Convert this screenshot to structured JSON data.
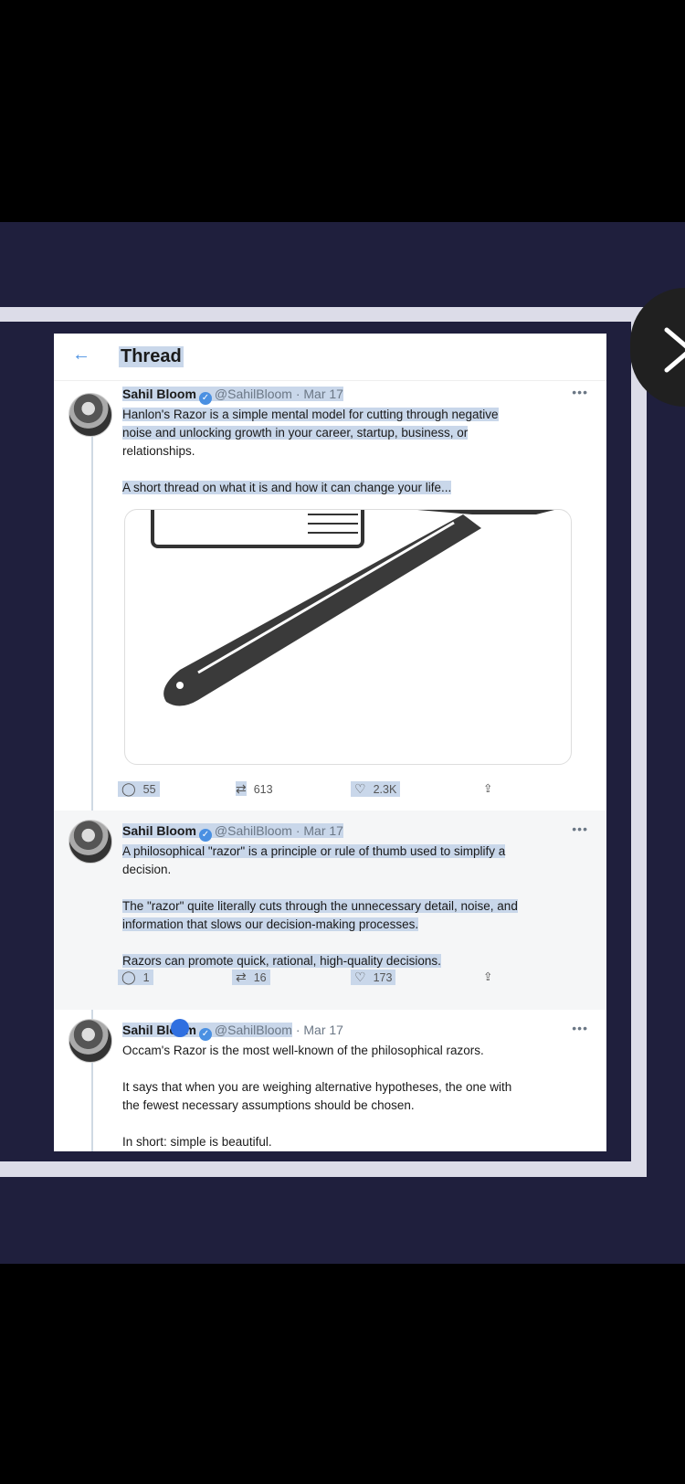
{
  "header": {
    "back_icon": "arrow-left-icon",
    "title": "Thread"
  },
  "close_icon": "close-x-icon",
  "tweets": [
    {
      "name": "Sahil Bloom",
      "handle": "@SahilBloom",
      "date": "· Mar 17",
      "lines": [
        "Hanlon's Razor is a simple mental model for cutting through negative",
        "noise and unlocking growth in your career, startup, business, or",
        "relationships.",
        "",
        "A short thread on what it is and how it can change your life..."
      ],
      "replies": "55",
      "retweets": "613",
      "likes": "2.3K"
    },
    {
      "name": "Sahil Bloom",
      "handle": "@SahilBloom",
      "date": "· Mar 17",
      "lines": [
        "A philosophical \"razor\" is a principle or rule of thumb used to simplify a",
        "decision.",
        "",
        "The \"razor\" quite literally cuts through the unnecessary detail, noise, and",
        "information that slows our decision-making processes.",
        "",
        "Razors can promote quick, rational, high-quality decisions."
      ],
      "replies": "1",
      "retweets": "16",
      "likes": "173"
    },
    {
      "name": "Sahil Bloom",
      "handle": "@SahilBloom",
      "date": "· Mar 17",
      "lines": [
        "Occam's Razor is the most well-known of the philosophical razors.",
        "",
        "It says that when you are weighing alternative hypotheses, the one with",
        "the fewest necessary assumptions should be chosen.",
        "",
        "In short: simple is beautiful."
      ]
    }
  ],
  "colors": {
    "navy": "#1f1f3d",
    "highlight": "#c9d7ea",
    "accent": "#4a90e2"
  }
}
